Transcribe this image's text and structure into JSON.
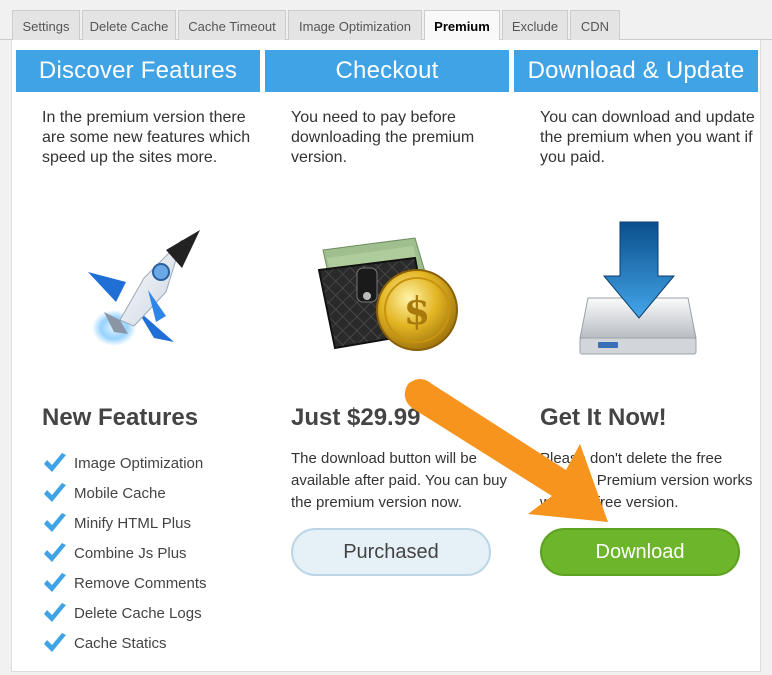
{
  "tabs": [
    {
      "label": "Settings"
    },
    {
      "label": "Delete Cache"
    },
    {
      "label": "Cache Timeout"
    },
    {
      "label": "Image Optimization"
    },
    {
      "label": "Premium",
      "active": true
    },
    {
      "label": "Exclude"
    },
    {
      "label": "CDN"
    }
  ],
  "columns": {
    "features": {
      "header": "Discover Features",
      "description": "In the premium version there are some new features which speed up the sites more.",
      "image_icon": "rocket-icon",
      "subtitle": "New Features",
      "items": [
        "Image Optimization",
        "Mobile Cache",
        "Minify HTML Plus",
        "Combine Js Plus",
        "Remove Comments",
        "Delete Cache Logs",
        "Cache Statics"
      ]
    },
    "checkout": {
      "header": "Checkout",
      "description": "You need to pay before downloading the premium version.",
      "image_icon": "wallet-coin-icon",
      "subtitle": "Just $29.99",
      "body": "The download button will be available after paid. You can buy the premium version now.",
      "button": "Purchased"
    },
    "download": {
      "header": "Download & Update",
      "description": "You can download and update the premium when you want if you paid.",
      "image_icon": "download-drive-icon",
      "subtitle": "Get It Now!",
      "body": "Please don't delete the free version. Premium version works with the free version.",
      "button": "Download"
    }
  },
  "colors": {
    "header_blue": "#3fa3e6",
    "download_green": "#6db52a",
    "annotation_arrow": "#f7941d",
    "check_blue": "#3fa3e6"
  }
}
